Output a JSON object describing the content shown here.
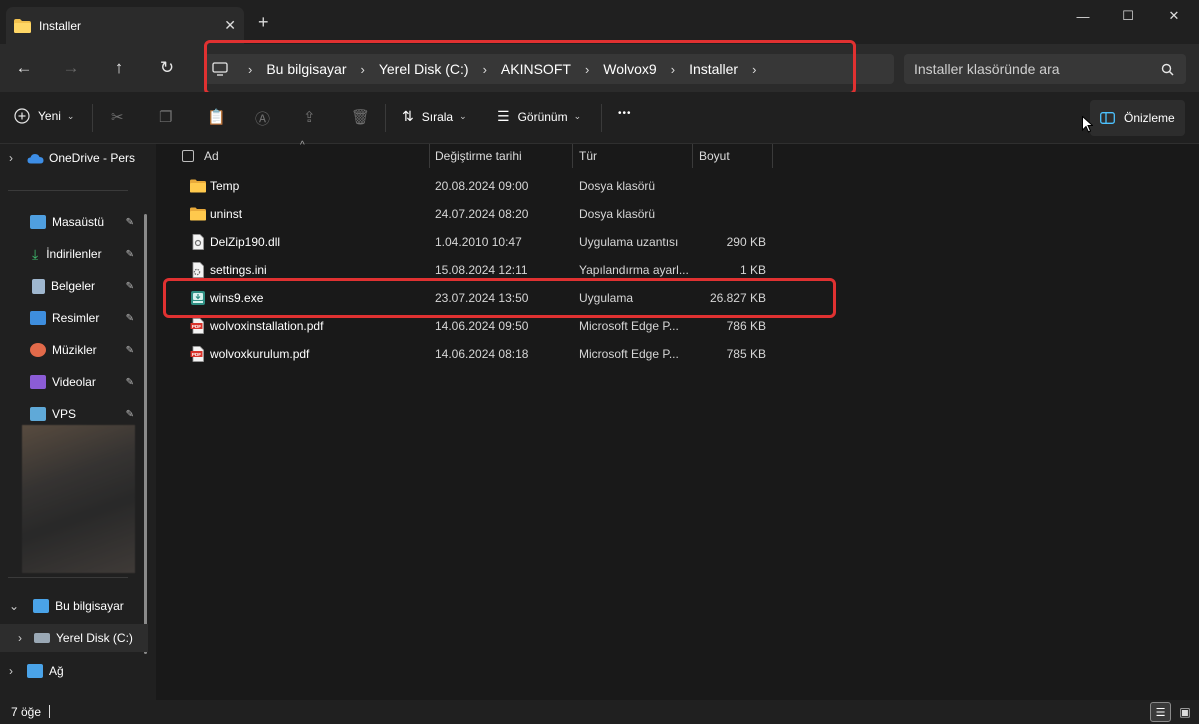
{
  "window": {
    "tab_title": "Installer",
    "new_tab_glyph": "+",
    "tab_close_glyph": "✕",
    "minimize_glyph": "—",
    "maximize_glyph": "☐",
    "close_glyph": "✕"
  },
  "nav": {
    "back_glyph": "←",
    "forward_glyph": "→",
    "up_glyph": "↑",
    "refresh_glyph": "↻",
    "breadcrumbs": [
      "Bu bilgisayar",
      "Yerel Disk (C:)",
      "AKINSOFT",
      "Wolvox9",
      "Installer"
    ],
    "chevron": "›",
    "search_placeholder": "Installer klasöründe ara",
    "search_icon": "search-icon"
  },
  "toolbar": {
    "new_label": "Yeni",
    "sort_label": "Sırala",
    "view_label": "Görünüm",
    "more_glyph": "•••",
    "preview_label": "Önizleme",
    "caret_glyph": "⌄"
  },
  "sidebar": {
    "onedrive": "OneDrive - Pers",
    "quick": [
      {
        "label": "Masaüstü",
        "color": "#4f9fe0"
      },
      {
        "label": "İndirilenler",
        "color": "#3fbf6f"
      },
      {
        "label": "Belgeler",
        "color": "#9fb7cf"
      },
      {
        "label": "Resimler",
        "color": "#3e8ede"
      },
      {
        "label": "Müzikler",
        "color": "#e26a4a"
      },
      {
        "label": "Videolar",
        "color": "#8b5cd6"
      },
      {
        "label": "VPS",
        "color": "#5fa9d8"
      }
    ],
    "this_pc": "Bu bilgisayar",
    "local_disk": "Yerel Disk (C:)",
    "network": "Ağ",
    "pin_glyph": "📌",
    "expand_glyph": "›",
    "collapse_glyph": "⌄"
  },
  "columns": {
    "name": "Ad",
    "modified": "Değiştirme tarihi",
    "type": "Tür",
    "size": "Boyut",
    "sort_glyph": "^"
  },
  "files": [
    {
      "name": "Temp",
      "modified": "20.08.2024 09:00",
      "type": "Dosya klasörü",
      "size": "",
      "icon": "folder-icon"
    },
    {
      "name": "uninst",
      "modified": "24.07.2024 08:20",
      "type": "Dosya klasörü",
      "size": "",
      "icon": "folder-icon"
    },
    {
      "name": "DelZip190.dll",
      "modified": "1.04.2010 10:47",
      "type": "Uygulama uzantısı",
      "size": "290 KB",
      "icon": "dll-icon"
    },
    {
      "name": "settings.ini",
      "modified": "15.08.2024 12:11",
      "type": "Yapılandırma ayarl...",
      "size": "1 KB",
      "icon": "ini-icon"
    },
    {
      "name": "wins9.exe",
      "modified": "23.07.2024 13:50",
      "type": "Uygulama",
      "size": "26.827 KB",
      "icon": "exe-icon"
    },
    {
      "name": "wolvoxinstallation.pdf",
      "modified": "14.06.2024 09:50",
      "type": "Microsoft Edge P...",
      "size": "786 KB",
      "icon": "pdf-icon"
    },
    {
      "name": "wolvoxkurulum.pdf",
      "modified": "14.06.2024 08:18",
      "type": "Microsoft Edge P...",
      "size": "785 KB",
      "icon": "pdf-icon"
    }
  ],
  "status": {
    "count": "7 öğe"
  },
  "colors": {
    "highlight": "#e03131",
    "folder": "#f2c14e",
    "accent": "#4cc2ff"
  }
}
